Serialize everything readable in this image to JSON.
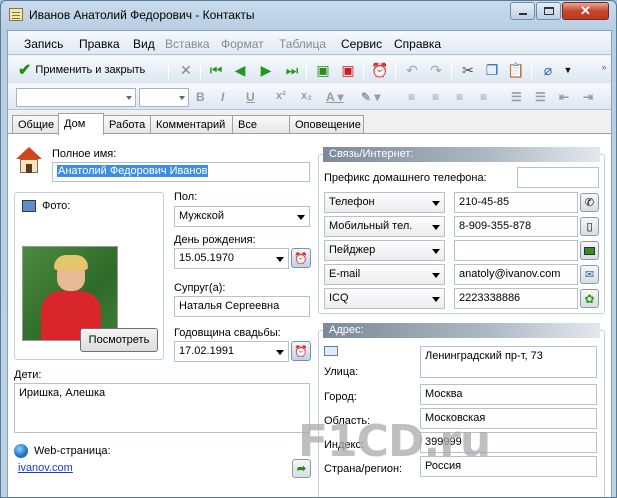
{
  "window": {
    "title": "Иванов Анатолий Федорович - Контакты"
  },
  "menu": [
    "Запись",
    "Правка",
    "Вид",
    "Вставка",
    "Формат",
    "Таблица",
    "Сервис",
    "Справка"
  ],
  "menu_disabled": [
    false,
    false,
    false,
    true,
    true,
    true,
    false,
    false
  ],
  "toolbar": {
    "save_close": "Применить и закрыть"
  },
  "tabs": [
    "Общие",
    "Дом",
    "Работа",
    "Комментарий",
    "Все поля",
    "Оповещение"
  ],
  "active_tab": "Дом",
  "home": {
    "full_name_label": "Полное имя:",
    "full_name": "Анатолий Федорович Иванов",
    "photo_label": "Фото:",
    "view_button": "Посмотреть",
    "gender_label": "Пол:",
    "gender": "Мужской",
    "birthday_label": "День рождения:",
    "birthday": "15.05.1970",
    "spouse_label": "Супруг(а):",
    "spouse": "Наталья Сергеевна",
    "anniversary_label": "Годовщина свадьбы:",
    "anniversary": "17.02.1991",
    "children_label": "Дети:",
    "children": "Иришка, Алешка",
    "web_label": "Web-страница:",
    "web": "ivanov.com"
  },
  "comm": {
    "header": "Связь/Интернет:",
    "prefix_label": "Префикс домашнего телефона:",
    "prefix": "",
    "rows": [
      {
        "type": "Телефон",
        "value": "210-45-85",
        "icon": "phone-handset-icon"
      },
      {
        "type": "Мобильный тел.",
        "value": "8-909-355-878",
        "icon": "mobile-phone-icon"
      },
      {
        "type": "Пейджер",
        "value": "",
        "icon": "pager-icon"
      },
      {
        "type": "E-mail",
        "value": "anatoly@ivanov.com",
        "icon": "envelope-icon"
      },
      {
        "type": "ICQ",
        "value": "2223338886",
        "icon": "icq-flower-icon"
      }
    ]
  },
  "address": {
    "header": "Адрес:",
    "street_label": "Улица:",
    "street": "Ленинградский пр-т, 73",
    "city_label": "Город:",
    "city": "Москва",
    "region_label": "Область:",
    "region": "Московская",
    "zip_label": "Индекс:",
    "zip": "399999",
    "country_label": "Страна/регион:",
    "country": "Россия"
  },
  "watermark": "F1CD.ru"
}
